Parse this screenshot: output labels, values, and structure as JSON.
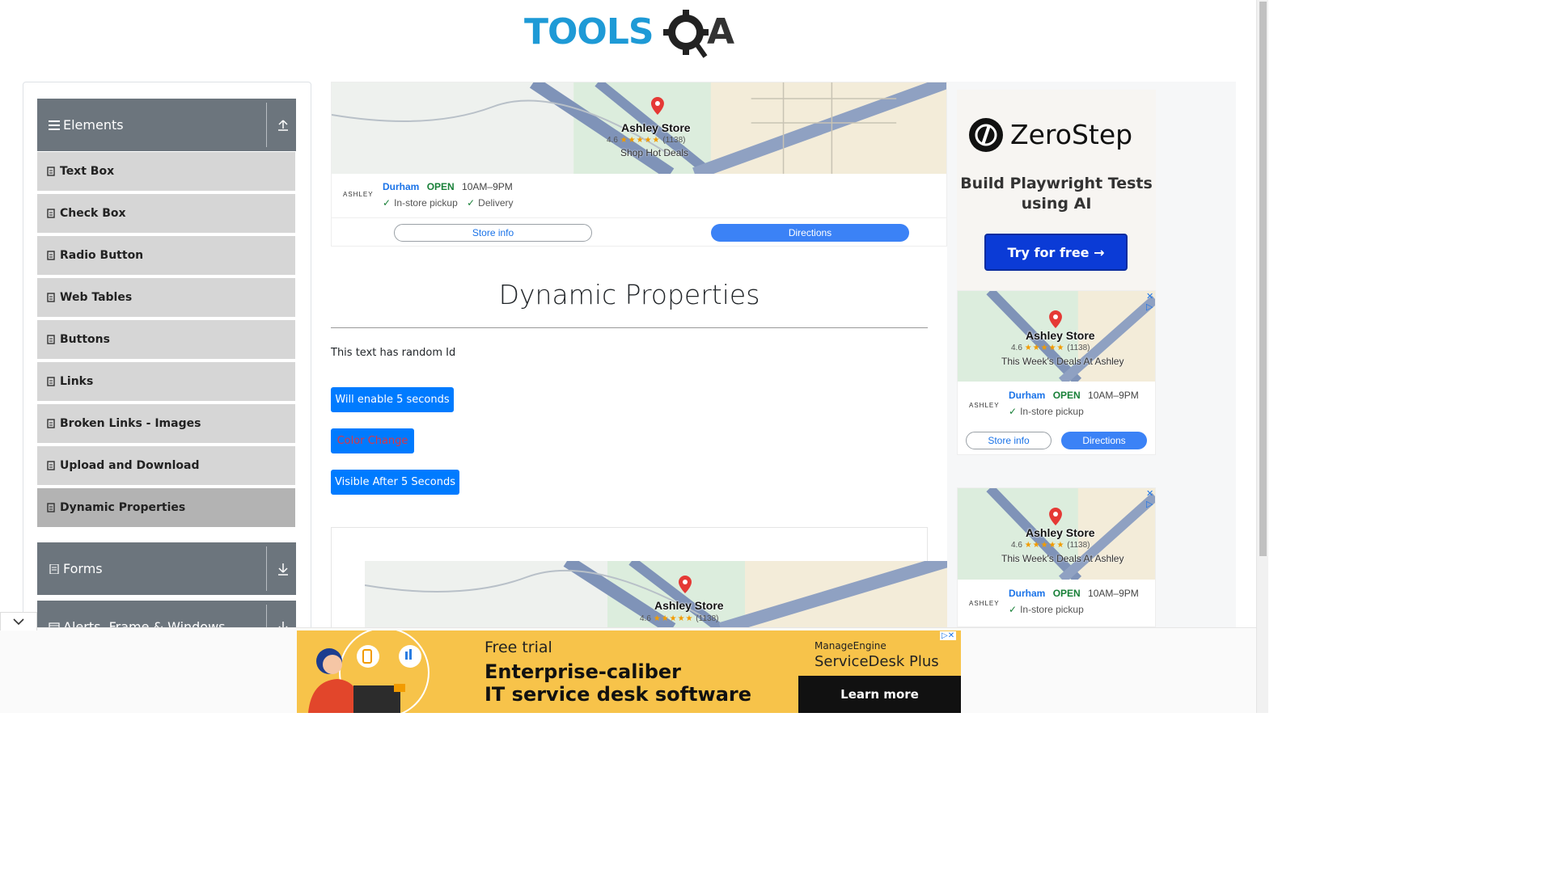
{
  "header": {
    "logo_text": "TOOLSQA"
  },
  "sidebar": {
    "groups": [
      {
        "label": "Elements"
      },
      {
        "label": "Forms"
      },
      {
        "label": "Alerts, Frame & Windows"
      }
    ],
    "items": [
      {
        "label": "Text Box"
      },
      {
        "label": "Check Box"
      },
      {
        "label": "Radio Button"
      },
      {
        "label": "Web Tables"
      },
      {
        "label": "Buttons"
      },
      {
        "label": "Links"
      },
      {
        "label": "Broken Links - Images"
      },
      {
        "label": "Upload and Download"
      },
      {
        "label": "Dynamic Properties"
      }
    ],
    "active_item": "Dynamic Properties"
  },
  "top_ad": {
    "store_name": "Ashley Store",
    "rating": "4.6",
    "stars": "★★★★★",
    "reviews": "(1138)",
    "tagline": "Shop Hot Deals",
    "logo": "ASHLEY",
    "city": "Durham",
    "status": "OPEN",
    "hours": "10AM–9PM",
    "feature1": "In-store pickup",
    "feature2": "Delivery",
    "store_info": "Store info",
    "directions": "Directions"
  },
  "main": {
    "title": "Dynamic Properties",
    "random_text": "This text has random Id",
    "buttons": {
      "enable_after": "Will enable 5 seconds",
      "color_change": "Color Change",
      "visible_after": "Visible After 5 Seconds"
    }
  },
  "lower_ad": {
    "store_name": "Ashley Store",
    "rating": "4.6",
    "stars": "★★★★★",
    "reviews": "(1138)"
  },
  "side_ad": {
    "brand": "ZeroStep",
    "headline": "Build Playwright Tests using AI",
    "cta": "Try for free →"
  },
  "side_map_ads": [
    {
      "store_name": "Ashley Store",
      "rating": "4.6",
      "stars": "★★★★★",
      "reviews": "(1138)",
      "tagline": "This Week's Deals At Ashley",
      "logo": "ASHLEY",
      "city": "Durham",
      "status": "OPEN",
      "hours": "10AM–9PM",
      "feature1": "In-store pickup",
      "store_info": "Store info",
      "directions": "Directions"
    },
    {
      "store_name": "Ashley Store",
      "rating": "4.6",
      "stars": "★★★★★",
      "reviews": "(1138)",
      "tagline": "This Week's Deals At Ashley",
      "logo": "ASHLEY",
      "city": "Durham",
      "status": "OPEN",
      "hours": "10AM–9PM",
      "feature1": "In-store pickup"
    }
  ],
  "bottom_ad": {
    "kicker": "Free trial",
    "line1": "Enterprise-caliber",
    "line2": "IT service desk software",
    "brand_small": "ManageEngine",
    "brand": "ServiceDesk Plus",
    "cta": "Learn more"
  },
  "colors": {
    "primary": "#007bff",
    "sidebar_header": "#6c757d",
    "sidebar_item": "#d6d6d6",
    "sidebar_active": "#b3b3b3",
    "logo_blue": "#1e9ad6",
    "logo_dark": "#111111"
  }
}
